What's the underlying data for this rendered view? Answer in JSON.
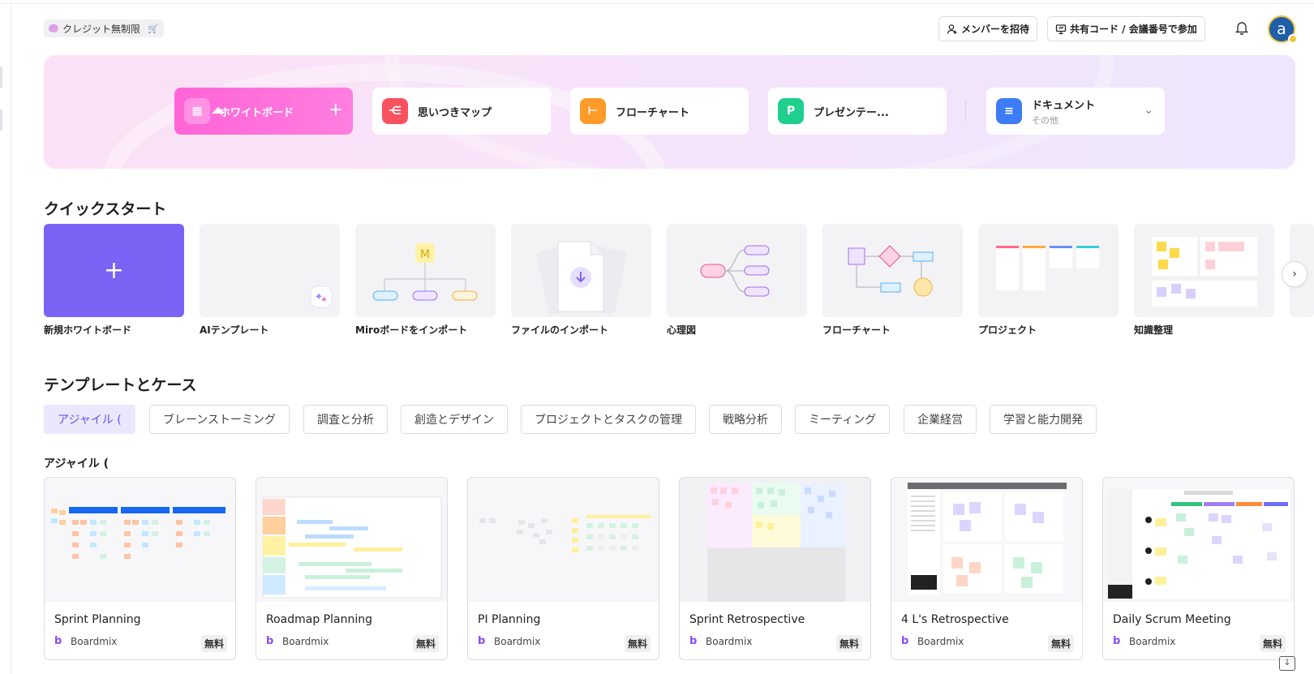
{
  "header": {
    "credit_label": "クレジット無制限",
    "invite_label": "メンバーを招待",
    "join_label": "共有コード / 会議番号で参加",
    "avatar_letter": "a"
  },
  "create": {
    "items": [
      {
        "label": "ホワイトボード",
        "icon": "whiteboard-icon",
        "color": "#ff64d6"
      },
      {
        "label": "思いつきマップ",
        "icon": "mindmap-icon",
        "color": "#f8525f"
      },
      {
        "label": "フローチャート",
        "icon": "flowchart-icon",
        "color": "#ff9b28"
      },
      {
        "label": "プレゼンテー...",
        "icon": "presentation-icon",
        "color": "#1fcf8e"
      },
      {
        "label": "ドキュメント",
        "sub": "その他",
        "icon": "document-icon",
        "color": "#3d7cf4"
      }
    ]
  },
  "quickstart": {
    "title": "クイックスタート",
    "items": [
      {
        "label": "新規ホワイトボード"
      },
      {
        "label": "AIテンプレート"
      },
      {
        "label": "Miroボードをインポート"
      },
      {
        "label": "ファイルのインポート"
      },
      {
        "label": "心理図"
      },
      {
        "label": "フローチャート"
      },
      {
        "label": "プロジェクト"
      },
      {
        "label": "知識整理"
      }
    ]
  },
  "templates": {
    "title": "テンプレートとケース",
    "categories": [
      "アジャイル (",
      "ブレーンストーミング",
      "調査と分析",
      "創造とデザイン",
      "プロジェクトとタスクの管理",
      "戦略分析",
      "ミーティング",
      "企業経営",
      "学習と能力開発"
    ],
    "active_category": "アジャイル (",
    "section_label": "アジャイル (",
    "cards": [
      {
        "name": "Sprint Planning",
        "brand": "Boardmix",
        "price": "無料"
      },
      {
        "name": "Roadmap Planning",
        "brand": "Boardmix",
        "price": "無料"
      },
      {
        "name": "PI Planning",
        "brand": "Boardmix",
        "price": "無料"
      },
      {
        "name": "Sprint Retrospective",
        "brand": "Boardmix",
        "price": "無料"
      },
      {
        "name": "4 L's Retrospective",
        "brand": "Boardmix",
        "price": "無料"
      },
      {
        "name": "Daily Scrum Meeting",
        "brand": "Boardmix",
        "price": "無料"
      }
    ]
  },
  "colors": {
    "accent": "#7a63f4",
    "whiteboard_pink": "#ff64d6"
  }
}
